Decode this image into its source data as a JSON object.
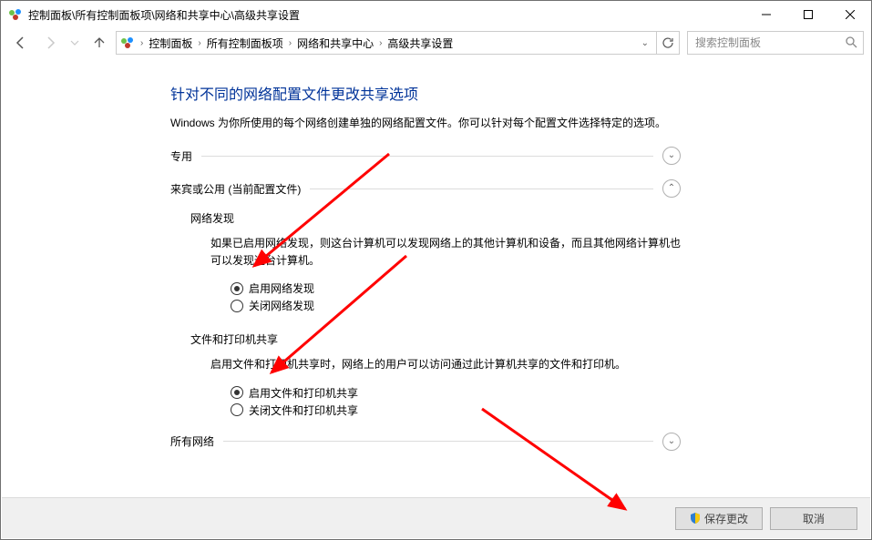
{
  "window": {
    "title": "控制面板\\所有控制面板项\\网络和共享中心\\高级共享设置"
  },
  "breadcrumbs": {
    "items": [
      "控制面板",
      "所有控制面板项",
      "网络和共享中心",
      "高级共享设置"
    ]
  },
  "search": {
    "placeholder": "搜索控制面板"
  },
  "page": {
    "title": "针对不同的网络配置文件更改共享选项",
    "desc": "Windows 为你所使用的每个网络创建单独的网络配置文件。你可以针对每个配置文件选择特定的选项。"
  },
  "sections": {
    "private": {
      "label": "专用"
    },
    "guest": {
      "label": "来宾或公用 (当前配置文件)",
      "discovery": {
        "title": "网络发现",
        "desc": "如果已启用网络发现，则这台计算机可以发现网络上的其他计算机和设备，而且其他网络计算机也可以发现这台计算机。",
        "on": "启用网络发现",
        "off": "关闭网络发现"
      },
      "fileshare": {
        "title": "文件和打印机共享",
        "desc": "启用文件和打印机共享时，网络上的用户可以访问通过此计算机共享的文件和打印机。",
        "on": "启用文件和打印机共享",
        "off": "关闭文件和打印机共享"
      }
    },
    "all": {
      "label": "所有网络"
    }
  },
  "footer": {
    "save": "保存更改",
    "cancel": "取消"
  }
}
